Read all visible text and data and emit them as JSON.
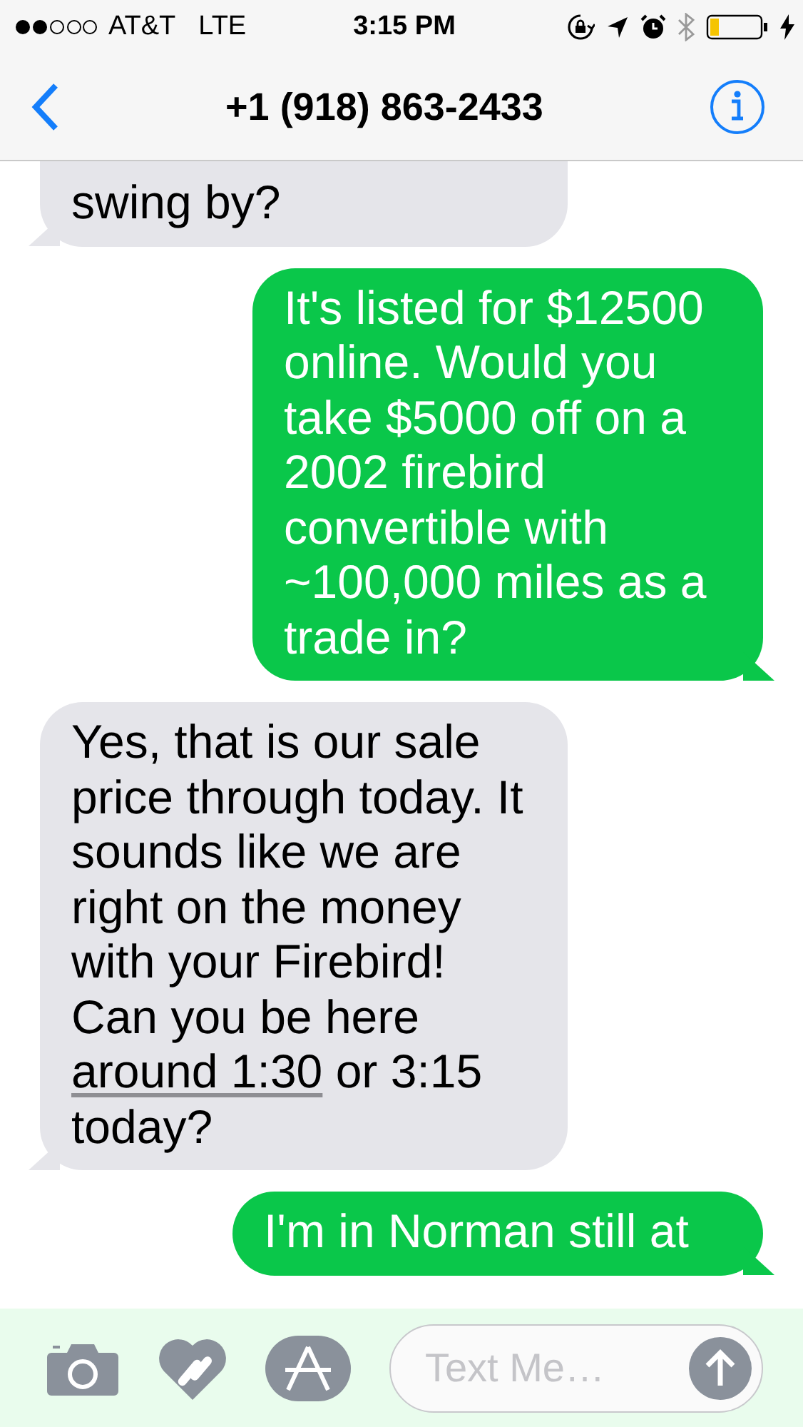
{
  "status_bar": {
    "carrier": "AT&T",
    "network": "LTE",
    "time": "3:15 PM"
  },
  "nav": {
    "title": "+1 (918) 863-2433"
  },
  "messages": [
    {
      "kind": "received",
      "parts": [
        {
          "text": "swing by?"
        }
      ]
    },
    {
      "kind": "sent",
      "parts": [
        {
          "text": "It's listed for $12500 online. Would you take $5000 off on a 2002 firebird convertible with ~100,000 miles as a trade in?"
        }
      ]
    },
    {
      "kind": "received",
      "parts": [
        {
          "text": "Yes, that is our sale price through today. It sounds like we are right on the money with your Firebird! Can you be here "
        },
        {
          "text": "around 1:30",
          "link": true
        },
        {
          "text": " or 3:15 today?"
        }
      ]
    },
    {
      "kind": "sent",
      "parts": [
        {
          "text": "I'm in Norman still at"
        }
      ]
    }
  ],
  "composer": {
    "placeholder": "Text Me…"
  }
}
